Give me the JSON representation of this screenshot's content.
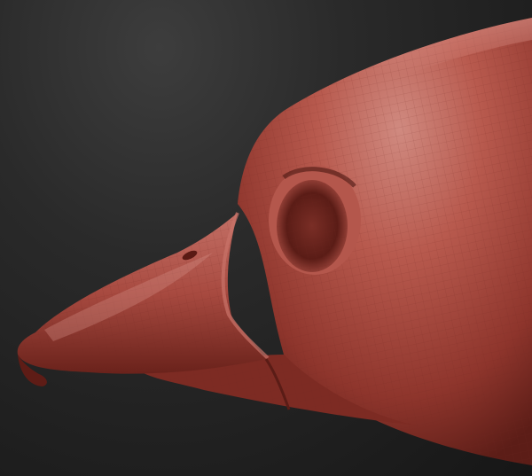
{
  "scene": {
    "subject": "duck-head-sculpt",
    "colors": {
      "background_top": "#3a3a3a",
      "background_bottom": "#141414",
      "clay_base": "#a8463c",
      "clay_highlight": "#cf7a70",
      "clay_shadow": "#5a1a14",
      "mesh_line": "#7a2a22"
    }
  }
}
